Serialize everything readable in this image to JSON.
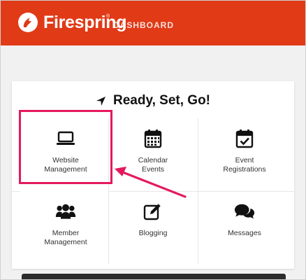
{
  "header": {
    "brand": "Firespring",
    "trademark": "®",
    "section": "DASHBOARD",
    "color": "#e03a17"
  },
  "card": {
    "title": "Ready, Set, Go!",
    "title_icon": "location-arrow-icon"
  },
  "tiles": [
    {
      "label": "Website\nManagement",
      "icon": "laptop-icon"
    },
    {
      "label": "Calendar\nEvents",
      "icon": "calendar-icon"
    },
    {
      "label": "Event\nRegistrations",
      "icon": "calendar-check-icon"
    },
    {
      "label": "Member\nManagement",
      "icon": "users-icon"
    },
    {
      "label": "Blogging",
      "icon": "edit-icon"
    },
    {
      "label": "Messages",
      "icon": "comments-icon"
    }
  ],
  "annotation": {
    "highlight_color": "#e5195f",
    "highlighted_tile": "Website Management"
  }
}
